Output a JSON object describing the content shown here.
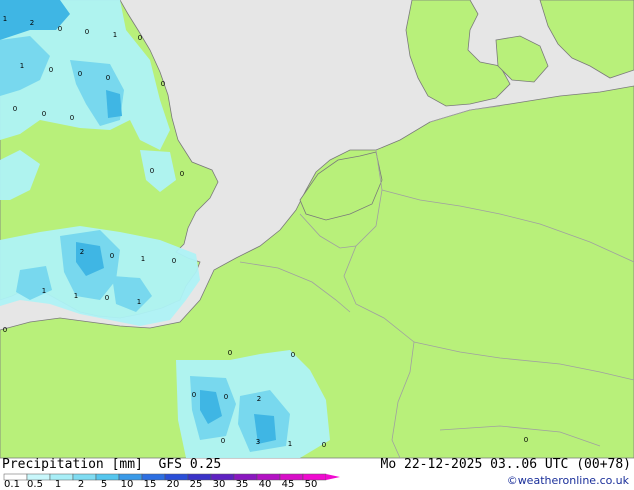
{
  "map": {
    "title": "Precipitation [mm]  GFS 0.25",
    "run_info": "Mo 22-12-2025 03..06 UTC (00+78)",
    "credit": "©weatheronline.co.uk",
    "colors": {
      "sea": "#e6e6e6",
      "land": "#b8f07a",
      "border": "#a0a0a0",
      "coast": "#7a7a7a",
      "precip_light": "#aef2f6",
      "precip_mid": "#78d8ee",
      "precip_heavy": "#3fb6e4"
    },
    "point_labels": [
      "1",
      "2",
      "0",
      "0",
      "1",
      "0",
      "1",
      "0",
      "0",
      "0",
      "0",
      "0",
      "0",
      "0",
      "0",
      "0",
      "2",
      "0",
      "1",
      "0",
      "1",
      "1",
      "0",
      "1",
      "0",
      "0",
      "0",
      "0",
      "0",
      "2",
      "0",
      "3",
      "1",
      "0",
      "0"
    ]
  },
  "legend": {
    "ticks": [
      "0.1",
      "0.5",
      "1",
      "2",
      "5",
      "10",
      "15",
      "20",
      "25",
      "30",
      "35",
      "40",
      "45",
      "50"
    ],
    "colors": [
      "#ffffff",
      "#c9f7fb",
      "#a8eef7",
      "#7fdcf2",
      "#55c6ee",
      "#3a9ae8",
      "#2d6fe2",
      "#2a4fd8",
      "#3a33c8",
      "#5e22c2",
      "#8a18c0",
      "#b312c4",
      "#d80ec8",
      "#f00ad0"
    ]
  }
}
